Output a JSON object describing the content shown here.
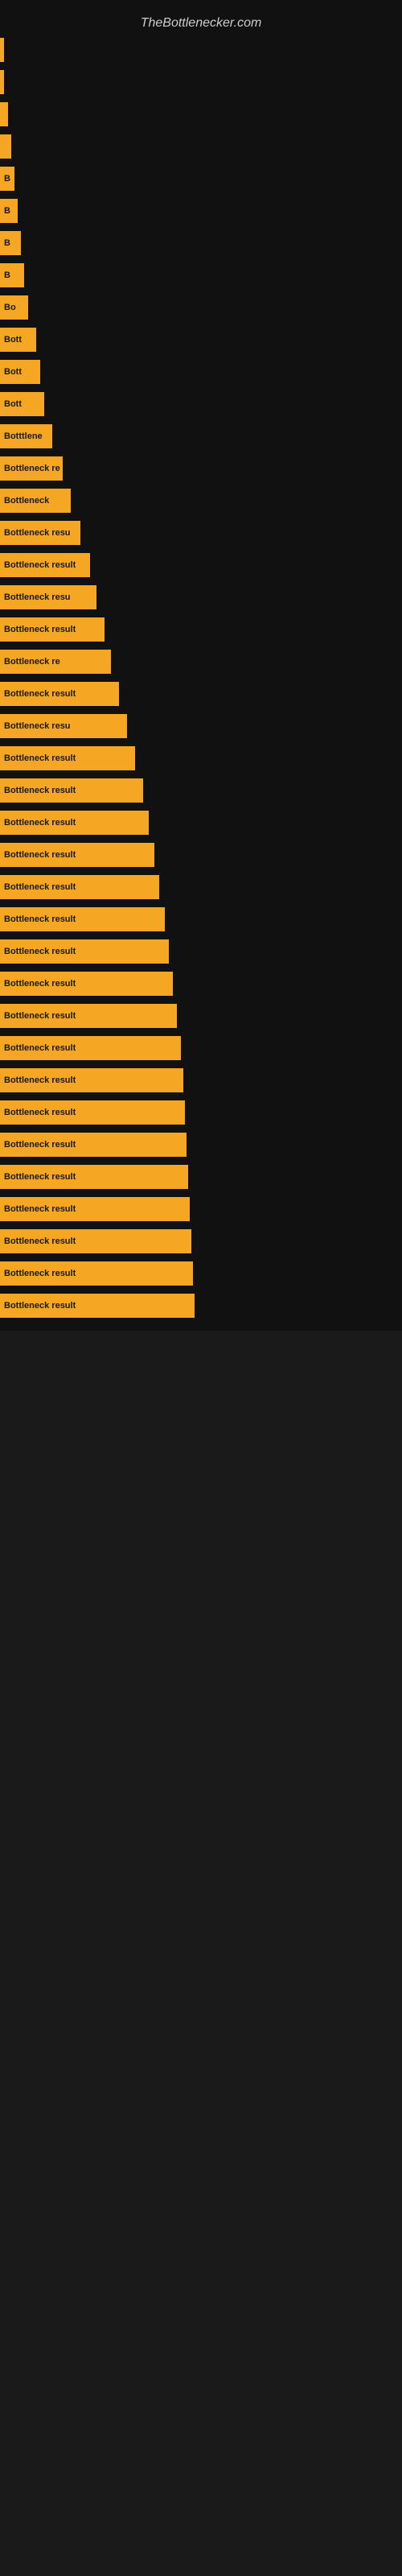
{
  "site": {
    "title": "TheBottlenecker.com"
  },
  "chart": {
    "bars": [
      {
        "id": 1,
        "label": "",
        "width_class": "bar-1"
      },
      {
        "id": 2,
        "label": "",
        "width_class": "bar-2"
      },
      {
        "id": 3,
        "label": "",
        "width_class": "bar-3"
      },
      {
        "id": 4,
        "label": "",
        "width_class": "bar-4"
      },
      {
        "id": 5,
        "label": "B",
        "width_class": "bar-5"
      },
      {
        "id": 6,
        "label": "B",
        "width_class": "bar-6"
      },
      {
        "id": 7,
        "label": "B",
        "width_class": "bar-7"
      },
      {
        "id": 8,
        "label": "B",
        "width_class": "bar-8"
      },
      {
        "id": 9,
        "label": "Bo",
        "width_class": "bar-9"
      },
      {
        "id": 10,
        "label": "Bott",
        "width_class": "bar-10"
      },
      {
        "id": 11,
        "label": "Bott",
        "width_class": "bar-11"
      },
      {
        "id": 12,
        "label": "Bott",
        "width_class": "bar-12"
      },
      {
        "id": 13,
        "label": "Botttlene",
        "width_class": "bar-13"
      },
      {
        "id": 14,
        "label": "Bottleneck re",
        "width_class": "bar-14"
      },
      {
        "id": 15,
        "label": "Bottleneck",
        "width_class": "bar-15"
      },
      {
        "id": 16,
        "label": "Bottleneck resu",
        "width_class": "bar-16"
      },
      {
        "id": 17,
        "label": "Bottleneck result",
        "width_class": "bar-17"
      },
      {
        "id": 18,
        "label": "Bottleneck resu",
        "width_class": "bar-18"
      },
      {
        "id": 19,
        "label": "Bottleneck result",
        "width_class": "bar-19"
      },
      {
        "id": 20,
        "label": "Bottleneck re",
        "width_class": "bar-20"
      },
      {
        "id": 21,
        "label": "Bottleneck result",
        "width_class": "bar-21"
      },
      {
        "id": 22,
        "label": "Bottleneck resu",
        "width_class": "bar-22"
      },
      {
        "id": 23,
        "label": "Bottleneck result",
        "width_class": "bar-23"
      },
      {
        "id": 24,
        "label": "Bottleneck result",
        "width_class": "bar-24"
      },
      {
        "id": 25,
        "label": "Bottleneck result",
        "width_class": "bar-25"
      },
      {
        "id": 26,
        "label": "Bottleneck result",
        "width_class": "bar-26"
      },
      {
        "id": 27,
        "label": "Bottleneck result",
        "width_class": "bar-27"
      },
      {
        "id": 28,
        "label": "Bottleneck result",
        "width_class": "bar-28"
      },
      {
        "id": 29,
        "label": "Bottleneck result",
        "width_class": "bar-29"
      },
      {
        "id": 30,
        "label": "Bottleneck result",
        "width_class": "bar-30"
      },
      {
        "id": 31,
        "label": "Bottleneck result",
        "width_class": "bar-31"
      },
      {
        "id": 32,
        "label": "Bottleneck result",
        "width_class": "bar-32"
      },
      {
        "id": 33,
        "label": "Bottleneck result",
        "width_class": "bar-33"
      },
      {
        "id": 34,
        "label": "Bottleneck result",
        "width_class": "bar-34"
      },
      {
        "id": 35,
        "label": "Bottleneck result",
        "width_class": "bar-35"
      },
      {
        "id": 36,
        "label": "Bottleneck result",
        "width_class": "bar-36"
      },
      {
        "id": 37,
        "label": "Bottleneck result",
        "width_class": "bar-37"
      },
      {
        "id": 38,
        "label": "Bottleneck result",
        "width_class": "bar-38"
      },
      {
        "id": 39,
        "label": "Bottleneck result",
        "width_class": "bar-39"
      },
      {
        "id": 40,
        "label": "Bottleneck result",
        "width_class": "bar-40"
      }
    ]
  }
}
